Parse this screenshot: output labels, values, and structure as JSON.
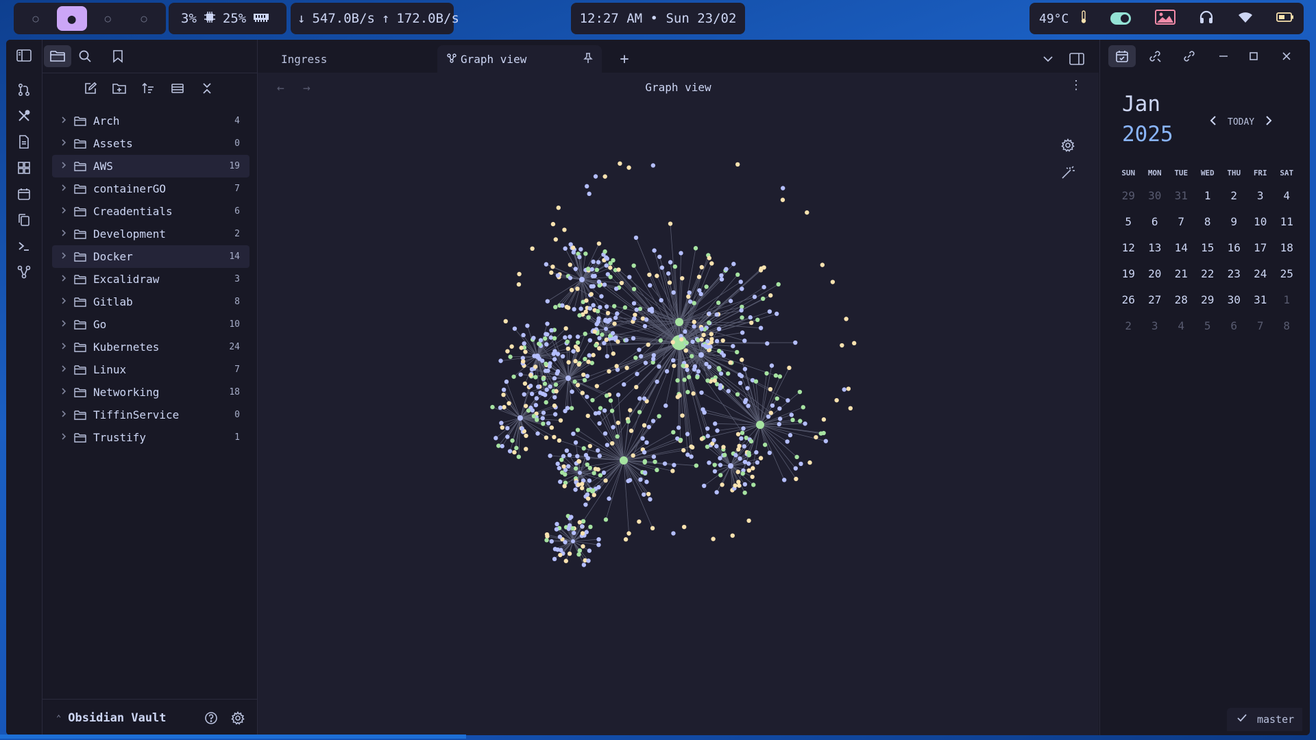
{
  "topbar": {
    "workspaces": [
      "○",
      "●",
      "○",
      "○"
    ],
    "cpu": "3%",
    "ram": "25%",
    "net_down": "547.0B/s",
    "net_up": "172.0B/s",
    "clock": "12:27 AM • Sun 23/02",
    "temperature": "49°C"
  },
  "tabs": [
    {
      "label": "Ingress"
    },
    {
      "label": "Graph view"
    }
  ],
  "view_title": "Graph view",
  "files": [
    {
      "name": "Arch",
      "count": "4"
    },
    {
      "name": "Assets",
      "count": "0"
    },
    {
      "name": "AWS",
      "count": "19"
    },
    {
      "name": "containerGO",
      "count": "7"
    },
    {
      "name": "Creadentials",
      "count": "6"
    },
    {
      "name": "Development",
      "count": "2"
    },
    {
      "name": "Docker",
      "count": "14"
    },
    {
      "name": "Excalidraw",
      "count": "3"
    },
    {
      "name": "Gitlab",
      "count": "8"
    },
    {
      "name": "Go",
      "count": "10"
    },
    {
      "name": "Kubernetes",
      "count": "24"
    },
    {
      "name": "Linux",
      "count": "7"
    },
    {
      "name": "Networking",
      "count": "18"
    },
    {
      "name": "TiffinService",
      "count": "0"
    },
    {
      "name": "Trustify",
      "count": "1"
    }
  ],
  "vault": {
    "name": "Obsidian Vault"
  },
  "calendar": {
    "month": "Jan",
    "year": "2025",
    "today_label": "TODAY",
    "weekdays": [
      "SUN",
      "MON",
      "TUE",
      "WED",
      "THU",
      "FRI",
      "SAT"
    ],
    "weeks": [
      [
        "29",
        "30",
        "31",
        "1",
        "2",
        "3",
        "4"
      ],
      [
        "5",
        "6",
        "7",
        "8",
        "9",
        "10",
        "11"
      ],
      [
        "12",
        "13",
        "14",
        "15",
        "16",
        "17",
        "18"
      ],
      [
        "19",
        "20",
        "21",
        "22",
        "23",
        "24",
        "25"
      ],
      [
        "26",
        "27",
        "28",
        "29",
        "30",
        "31",
        "1"
      ],
      [
        "2",
        "3",
        "4",
        "5",
        "6",
        "7",
        "8"
      ]
    ]
  },
  "status": {
    "branch": "master"
  },
  "colors": {
    "node_file": "#a6e3a1",
    "node_tag": "#b4befe",
    "node_orphan": "#f9e2af",
    "link": "#585b70"
  }
}
